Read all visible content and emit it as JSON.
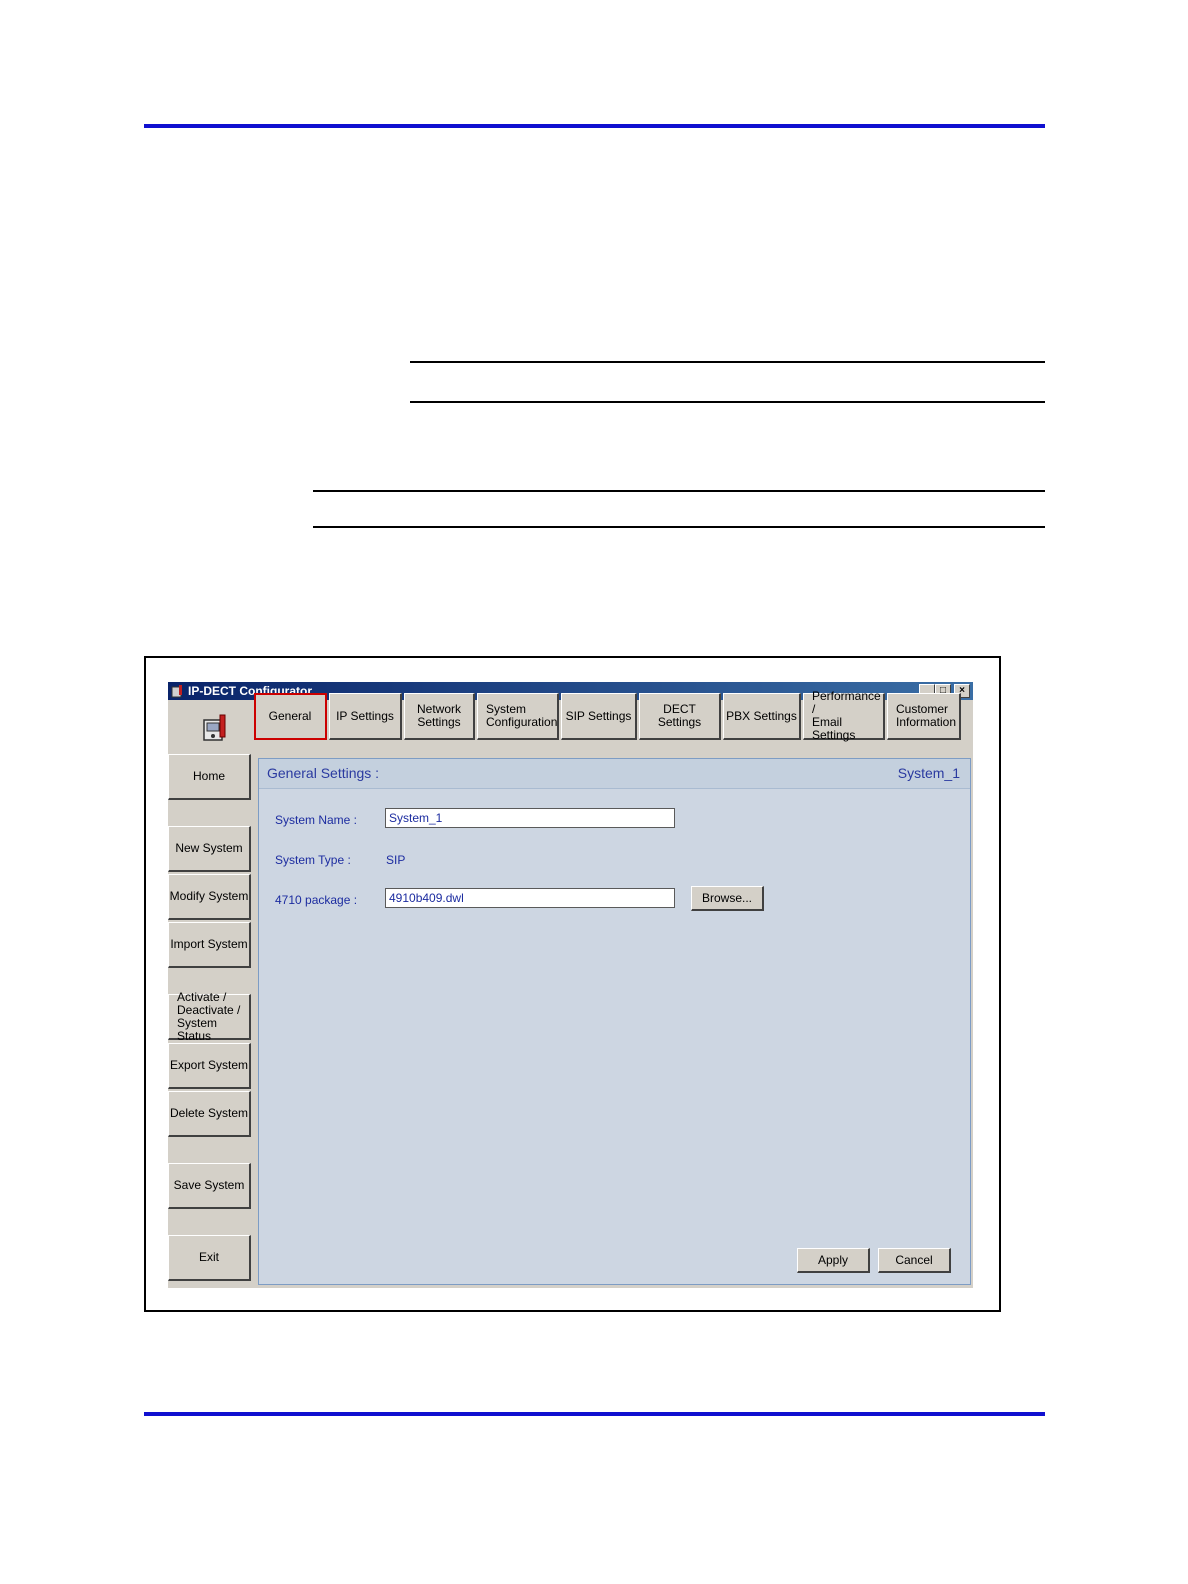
{
  "window": {
    "title": "IP-DECT Configurator",
    "minimize": "_",
    "maximize": "□",
    "close": "×"
  },
  "tabs": [
    {
      "label": "General"
    },
    {
      "label": "IP Settings"
    },
    {
      "label": "Network\nSettings"
    },
    {
      "label": "System\nConfiguration"
    },
    {
      "label": "SIP Settings"
    },
    {
      "label": "DECT Settings"
    },
    {
      "label": "PBX Settings"
    },
    {
      "label": "Performance /\nEmail Settings"
    },
    {
      "label": "Customer\nInformation"
    }
  ],
  "sidebar": [
    {
      "label": "Home"
    },
    {
      "label": "New System"
    },
    {
      "label": "Modify System"
    },
    {
      "label": "Import System"
    },
    {
      "label": "Activate /\nDeactivate /\nSystem Status"
    },
    {
      "label": "Export System"
    },
    {
      "label": "Delete System"
    },
    {
      "label": "Save System"
    },
    {
      "label": "Exit"
    }
  ],
  "panel": {
    "title": "General Settings :",
    "system": "System_1",
    "system_name_label": "System Name :",
    "system_name_value": "System_1",
    "system_type_label": "System Type :",
    "system_type_value": "SIP",
    "package_label": "4710 package :",
    "package_value": "4910b409.dwl",
    "browse": "Browse...",
    "apply": "Apply",
    "cancel": "Cancel"
  },
  "colors": {
    "rule": "#1010d0",
    "selected_tab_border": "#cc0000",
    "panel_bg": "#cdd6e2",
    "label_text": "#1c2ca0"
  }
}
